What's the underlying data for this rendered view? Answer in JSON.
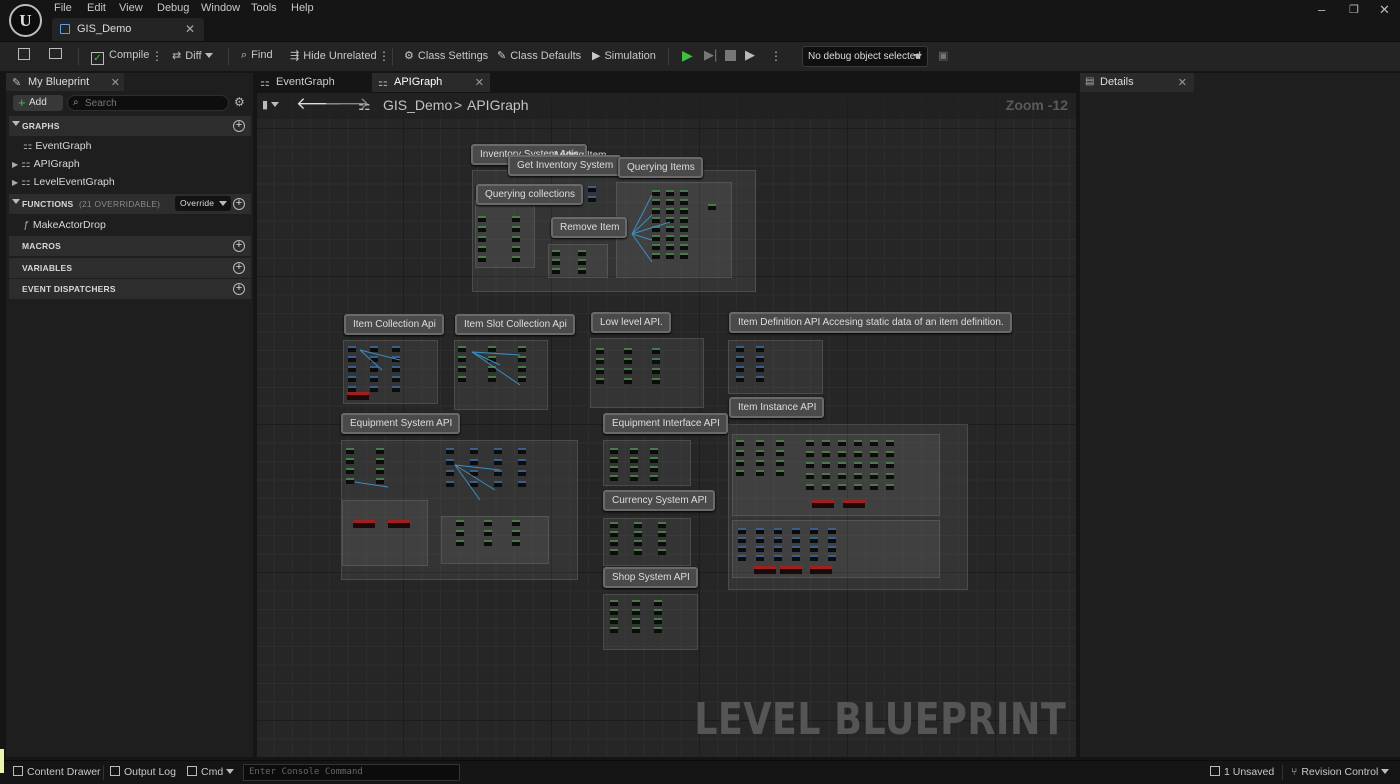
{
  "menu": [
    "File",
    "Edit",
    "View",
    "Debug",
    "Window",
    "Tools",
    "Help"
  ],
  "document_tab": "GIS_Demo",
  "window_controls": {
    "minimize": "–",
    "restore": "❐",
    "close": "✕"
  },
  "toolbar": {
    "compile": "Compile",
    "diff": "Diff",
    "find": "Find",
    "hide_unrelated": "Hide Unrelated",
    "class_settings": "Class Settings",
    "class_defaults": "Class Defaults",
    "simulation": "Simulation",
    "debug_object": "No debug object selected"
  },
  "my_blueprint": {
    "tab": "My Blueprint",
    "add": "Add",
    "search_placeholder": "Search",
    "sections": {
      "graphs": "GRAPHS",
      "functions": "FUNCTIONS",
      "functions_count": "(21 OVERRIDABLE)",
      "override": "Override",
      "macros": "MACROS",
      "variables": "VARIABLES",
      "event_dispatchers": "EVENT DISPATCHERS"
    },
    "graphs": [
      "EventGraph",
      "APIGraph",
      "LevelEventGraph"
    ],
    "functions": [
      "MakeActorDrop"
    ]
  },
  "graph_tabs": [
    "EventGraph",
    "APIGraph"
  ],
  "breadcrumb": {
    "root": "GIS_Demo",
    "separator": ">",
    "current": "APIGraph"
  },
  "zoom": "Zoom -12",
  "watermark": "LEVEL BLUEPRINT",
  "comments": [
    "Inventory System Apis",
    "Adding Item",
    "Get Inventory System",
    "Querying Items",
    "Querying collections",
    "Remove Item",
    "Item Collection Api",
    "Item Slot Collection Api",
    "Low level API.",
    "Item Definition API Accesing static data of an item definition.",
    "Item Instance API",
    "Equipment System API",
    "Equipment Interface API",
    "Currency System API",
    "Shop System API"
  ],
  "details": {
    "tab": "Details"
  },
  "statusbar": {
    "content_drawer": "Content Drawer",
    "output_log": "Output Log",
    "cmd": "Cmd",
    "console_placeholder": "Enter Console Command",
    "unsaved": "1 Unsaved",
    "revision_control": "Revision Control"
  },
  "colors": {
    "accent_green": "#3fbf3f",
    "accent_blue": "#5aa0e6",
    "error_red": "#a02020"
  }
}
